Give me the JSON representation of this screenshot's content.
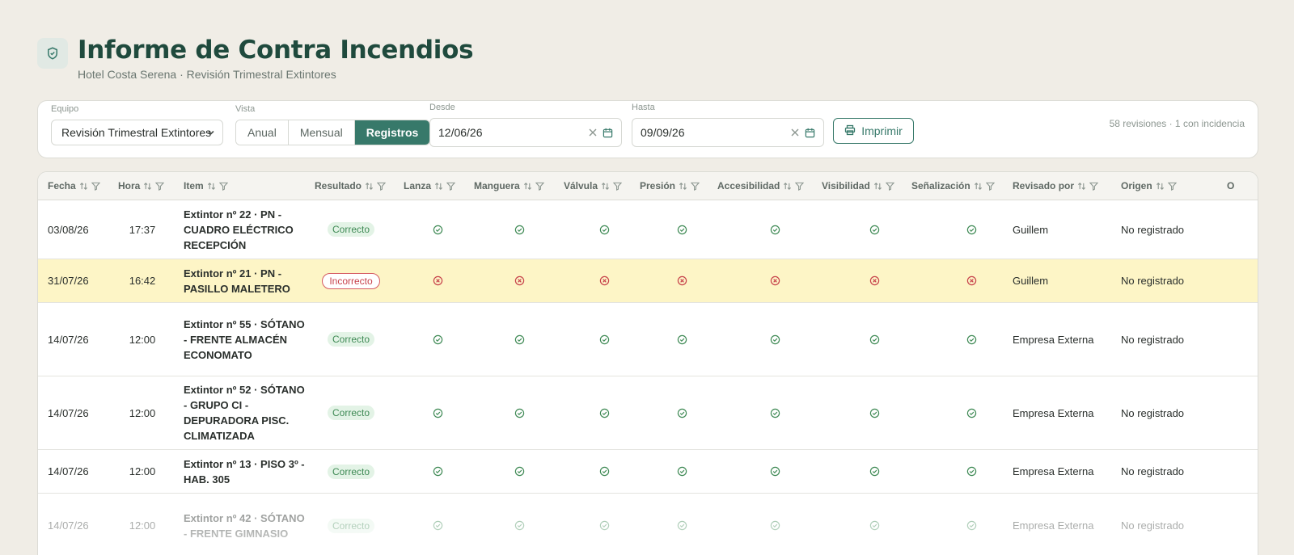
{
  "header": {
    "title": "Informe de Contra Incendios",
    "subtitle": "Hotel Costa Serena · Revisión Trimestral Extintores",
    "icon": "shield-check-icon"
  },
  "filters": {
    "equipo_label": "Equipo",
    "equipo_value": "Revisión Trimestral Extintores",
    "vista_label": "Vista",
    "vista_options": [
      "Anual",
      "Mensual",
      "Registros"
    ],
    "vista_selected": "Registros",
    "desde_label": "Desde",
    "desde_value": "12/06/26",
    "hasta_label": "Hasta",
    "hasta_value": "09/09/26",
    "print_label": "Imprimir",
    "summary": "58 revisiones · 1 con incidencia"
  },
  "table": {
    "columns": [
      "Fecha",
      "Hora",
      "Item",
      "Resultado",
      "Lanza",
      "Manguera",
      "Válvula",
      "Presión",
      "Accesibilidad",
      "Visibilidad",
      "Señalización",
      "Revisado por",
      "Origen",
      "O"
    ],
    "rows": [
      {
        "fecha": "03/08/26",
        "hora": "17:37",
        "item": "Extintor nº 22 · PN - CUADRO ELÉCTRICO RECEPCIÓN",
        "resultado": "Correcto",
        "status": "ok",
        "revisado": "Guillem",
        "origen": "No registrado"
      },
      {
        "fecha": "31/07/26",
        "hora": "16:42",
        "item": "Extintor nº 21 · PN - PASILLO MALETERO",
        "resultado": "Incorrecto",
        "status": "bad",
        "revisado": "Guillem",
        "origen": "No registrado"
      },
      {
        "fecha": "14/07/26",
        "hora": "12:00",
        "item": "Extintor nº 55 · SÓTANO - FRENTE ALMACÉN ECONOMATO",
        "resultado": "Correcto",
        "status": "ok",
        "revisado": "Empresa Externa",
        "origen": "No registrado"
      },
      {
        "fecha": "14/07/26",
        "hora": "12:00",
        "item": "Extintor nº 52 · SÓTANO - GRUPO CI - DEPURADORA PISC. CLIMATIZADA",
        "resultado": "Correcto",
        "status": "ok",
        "revisado": "Empresa Externa",
        "origen": "No registrado"
      },
      {
        "fecha": "14/07/26",
        "hora": "12:00",
        "item": "Extintor nº 13 · PISO 3º - HAB. 305",
        "resultado": "Correcto",
        "status": "ok",
        "revisado": "Empresa Externa",
        "origen": "No registrado"
      },
      {
        "fecha": "14/07/26",
        "hora": "12:00",
        "item": "Extintor nº 42 · SÓTANO - FRENTE GIMNASIO",
        "resultado": "Correcto",
        "status": "ok",
        "revisado": "Empresa Externa",
        "origen": "No registrado"
      }
    ]
  },
  "colors": {
    "accent": "#37796a",
    "title": "#1f4a3d",
    "ok": "#3f8a55",
    "bad": "#c7424a",
    "alert_row": "#fdf5c6"
  }
}
